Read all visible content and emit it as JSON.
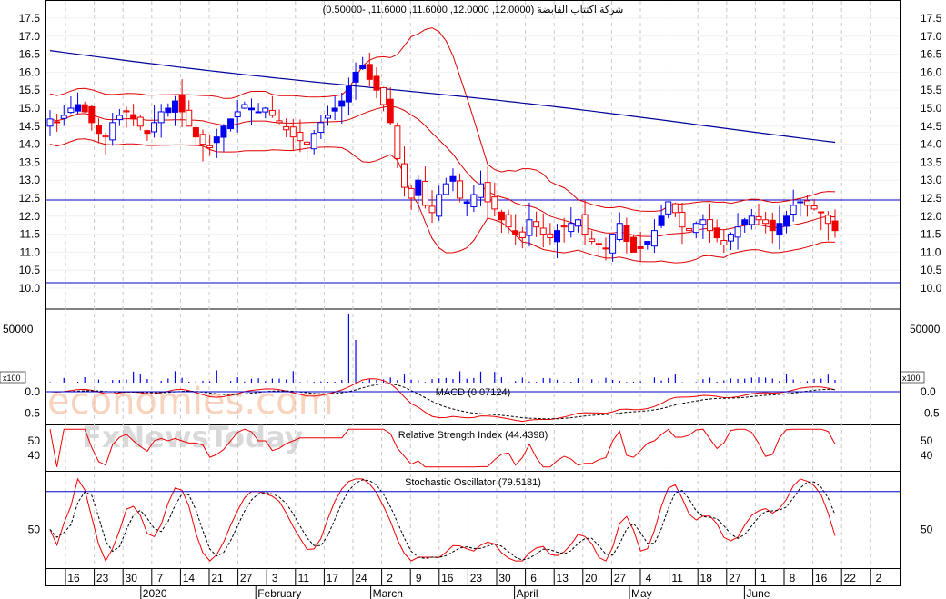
{
  "watermark": {
    "line1": "economies.com",
    "line2": "FxNewsToday"
  },
  "x_axis": {
    "day_ticks": [
      "16",
      "23",
      "30",
      "7",
      "14",
      "21",
      "27",
      "3",
      "11",
      "17",
      "24",
      "2",
      "9",
      "16",
      "23",
      "30",
      "6",
      "13",
      "20",
      "27",
      "4",
      "11",
      "18",
      "27",
      "1",
      "8",
      "16",
      "22",
      "2"
    ],
    "months": [
      "2020",
      "February",
      "March",
      "April",
      "May",
      "June"
    ]
  },
  "colors": {
    "up": "#0000ee",
    "down": "#ee0000",
    "bands": "#dd0000",
    "ma": "#000099",
    "grid": "#c8c8c8",
    "hline": "#0000cc"
  },
  "chart_data": [
    {
      "type": "candlestick",
      "title": "شركة اكتتاب القابضة (12.0000, 12.0000, 11.6000, 11.6000, -0.50000)",
      "ylim": [
        10.0,
        17.5
      ],
      "y_ticks": [
        "17.5",
        "17.0",
        "16.5",
        "16.0",
        "15.5",
        "15.0",
        "14.5",
        "14.0",
        "13.5",
        "13.0",
        "12.5",
        "12.0",
        "11.5",
        "11.0",
        "10.5",
        "10.0"
      ],
      "overlays": [
        "Bollinger Bands",
        "Moving Average"
      ],
      "hlines": [
        12.45,
        10.15
      ],
      "close": [
        14.7,
        14.6,
        14.8,
        15.0,
        15.1,
        14.9,
        14.6,
        14.3,
        14.2,
        14.6,
        14.8,
        14.9,
        14.7,
        14.5,
        14.3,
        14.6,
        14.9,
        15.0,
        15.2,
        14.9,
        14.5,
        14.2,
        14.0,
        13.9,
        14.2,
        14.5,
        14.7,
        14.9,
        15.1,
        15.0,
        14.9,
        15.0,
        14.8,
        14.6,
        14.4,
        14.2,
        14.1,
        14.0,
        14.3,
        14.6,
        14.8,
        15.0,
        15.2,
        15.6,
        16.0,
        16.2,
        15.8,
        15.5,
        15.1,
        14.6,
        13.6,
        12.8,
        12.5,
        13.0,
        12.3,
        12.1,
        12.6,
        12.9,
        13.1,
        12.5,
        12.4,
        12.6,
        12.9,
        12.4,
        12.2,
        11.9,
        11.7,
        11.5,
        11.4,
        11.9,
        11.7,
        11.5,
        11.4,
        11.6,
        11.7,
        11.8,
        11.9,
        11.5,
        11.3,
        11.2,
        11.1,
        11.5,
        11.8,
        11.3,
        11.0,
        11.1,
        11.3,
        11.6,
        12.0,
        12.4,
        12.1,
        11.7,
        11.6,
        11.8,
        11.9,
        11.6,
        11.4,
        11.2,
        11.5,
        11.7,
        11.9,
        12.0,
        11.9,
        11.8,
        11.6,
        11.8,
        12.0,
        12.3,
        12.4,
        12.3,
        12.2,
        12.1,
        11.8,
        11.6
      ],
      "volume_panel": {
        "y_ticks": [
          "50000"
        ],
        "unit": "x100"
      }
    },
    {
      "type": "line",
      "title": "MACD (0.07124)",
      "ylim": [
        -0.75,
        0.15
      ],
      "y_ticks": [
        "0.0",
        "-0.5"
      ],
      "series": [
        {
          "name": "MACD"
        },
        {
          "name": "Signal"
        }
      ]
    },
    {
      "type": "line",
      "title": "Relative Strength Index (44.4398)",
      "ylim": [
        30,
        60
      ],
      "y_ticks": [
        "50",
        "40"
      ]
    },
    {
      "type": "line",
      "title": "Stochastic Oscillator (79.5181)",
      "ylim": [
        20,
        95
      ],
      "y_ticks": [
        "50"
      ],
      "hlines": [
        80
      ]
    }
  ]
}
